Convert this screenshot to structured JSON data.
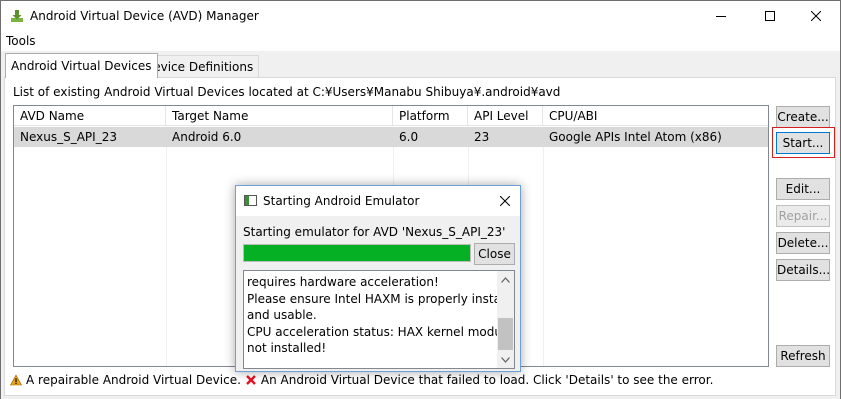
{
  "window": {
    "title": "Android Virtual Device (AVD) Manager"
  },
  "menu": {
    "tools": "Tools"
  },
  "tabs": [
    {
      "label": "Android Virtual Devices",
      "active": true
    },
    {
      "label": "Device Definitions",
      "active": false
    }
  ],
  "list_caption": "List of existing Android Virtual Devices located at C:¥Users¥Manabu Shibuya¥.android¥avd",
  "table": {
    "columns": [
      "AVD Name",
      "Target Name",
      "Platform",
      "API Level",
      "CPU/ABI"
    ],
    "rows": [
      [
        "Nexus_S_API_23",
        "Android 6.0",
        "6.0",
        "23",
        "Google APIs Intel Atom (x86)"
      ]
    ]
  },
  "buttons": {
    "create": "Create...",
    "start": "Start...",
    "edit": "Edit...",
    "repair": "Repair...",
    "delete": "Delete...",
    "details": "Details...",
    "refresh": "Refresh"
  },
  "status": {
    "repairable": "A repairable Android Virtual Device.",
    "failed": "An Android Virtual Device that failed to load. Click 'Details' to see the error."
  },
  "dialog": {
    "title": "Starting Android Emulator",
    "message": "Starting emulator for AVD 'Nexus_S_API_23'",
    "progress": 1.0,
    "close_label": "Close",
    "log_lines": [
      "requires hardware acceleration!",
      "Please ensure Intel HAXM is properly installed",
      "and usable.",
      "CPU acceleration status: HAX kernel module is",
      "not installed!"
    ]
  },
  "colors": {
    "progress_fill": "#06b025",
    "selection_row": "#d9d9d9",
    "highlight_box": "#d42020",
    "warning": "#e8a317",
    "error": "#e81123"
  },
  "icons": {
    "app": "android-download-icon",
    "minimize": "minimize-icon",
    "maximize": "maximize-icon",
    "close": "close-icon",
    "warning": "warning-icon",
    "error": "error-icon",
    "dialog": "emulator-window-icon"
  }
}
